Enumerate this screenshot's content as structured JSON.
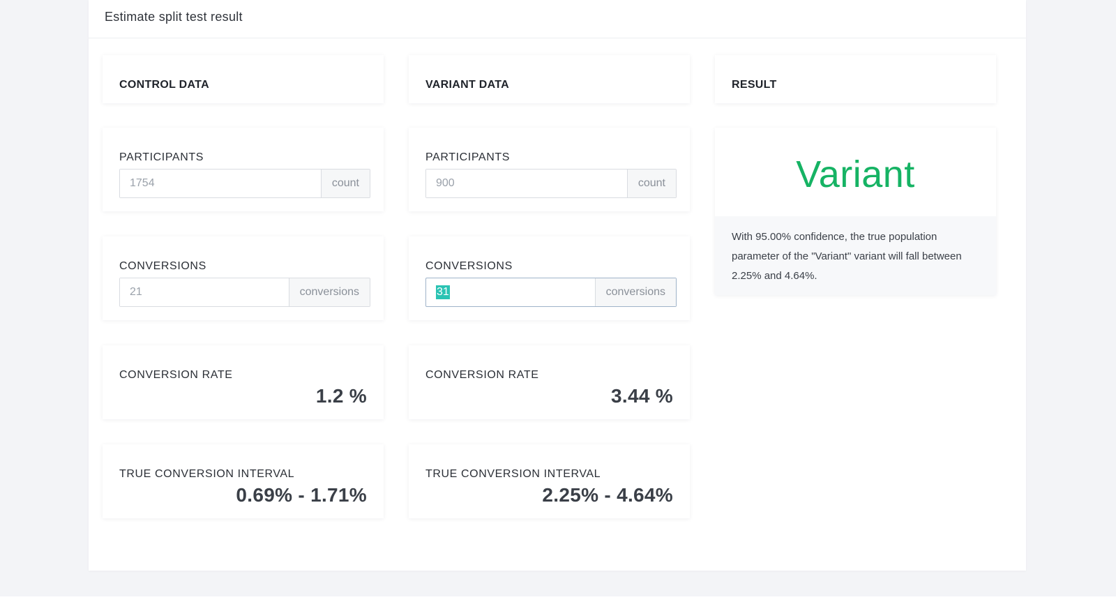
{
  "page_title": "Estimate split test result",
  "control": {
    "heading": "CONTROL DATA",
    "participants": {
      "label": "PARTICIPANTS",
      "value": "1754",
      "unit": "count"
    },
    "conversions": {
      "label": "CONVERSIONS",
      "value": "21",
      "unit": "conversions"
    },
    "conversion_rate": {
      "label": "CONVERSION RATE",
      "value": "1.2 %"
    },
    "interval": {
      "label": "TRUE CONVERSION INTERVAL",
      "value": "0.69% - 1.71%"
    }
  },
  "variant": {
    "heading": "VARIANT DATA",
    "participants": {
      "label": "PARTICIPANTS",
      "value": "900",
      "unit": "count"
    },
    "conversions": {
      "label": "CONVERSIONS",
      "value": "31",
      "unit": "conversions"
    },
    "conversion_rate": {
      "label": "CONVERSION RATE",
      "value": "3.44 %"
    },
    "interval": {
      "label": "TRUE CONVERSION INTERVAL",
      "value": "2.25% - 4.64%"
    }
  },
  "result": {
    "heading": "RESULT",
    "winner": "Variant",
    "description": "With 95.00% confidence, the true population parameter of the \"Variant\" variant will fall between 2.25% and 4.64%."
  },
  "colors": {
    "winner": "#16b364",
    "selection": "#2bc3b3",
    "background": "#f3f4f7"
  }
}
